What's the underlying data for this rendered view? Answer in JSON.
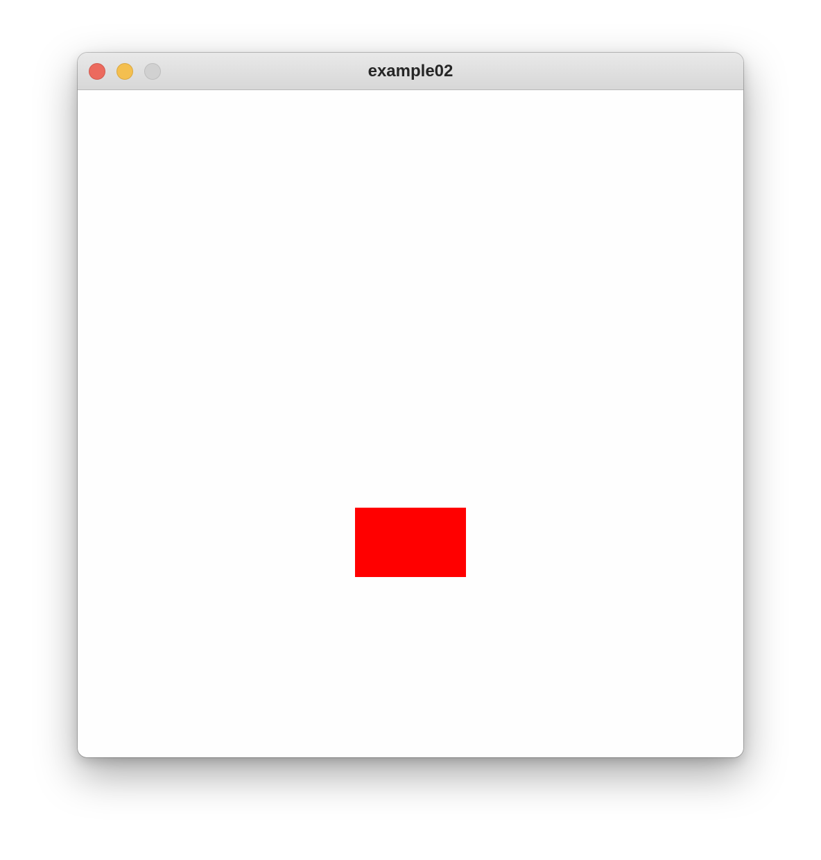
{
  "window": {
    "title": "example02",
    "buttons": {
      "close_color": "#ec6a5e",
      "minimize_color": "#f4bf4f",
      "zoom_color": "#d1d1d1"
    }
  },
  "canvas": {
    "background": "#fefefe",
    "shape_color": "#ff0000"
  }
}
